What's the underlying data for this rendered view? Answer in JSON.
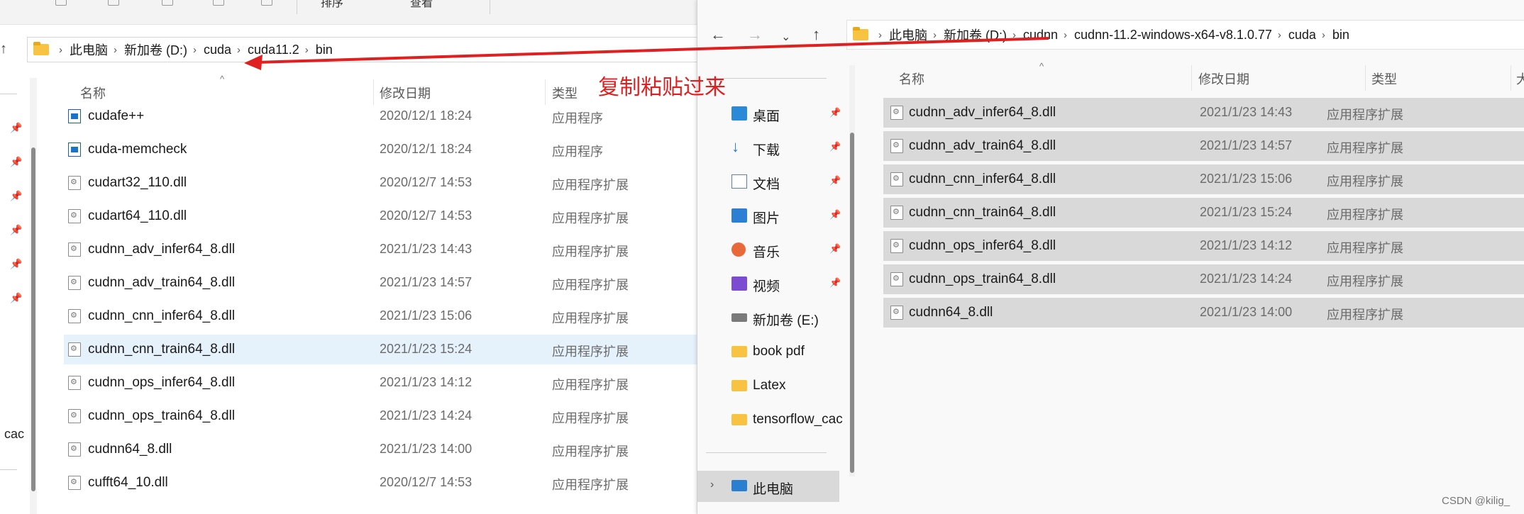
{
  "left_window": {
    "breadcrumb": [
      "此电脑",
      "新加卷 (D:)",
      "cuda",
      "cuda11.2",
      "bin"
    ],
    "columns": [
      "名称",
      "修改日期",
      "类型"
    ],
    "files": [
      {
        "name": "cudafe++",
        "date": "2020/12/1 18:24",
        "type": "应用程序",
        "icon": "exe-icon"
      },
      {
        "name": "cuda-memcheck",
        "date": "2020/12/1 18:24",
        "type": "应用程序",
        "icon": "exe-icon"
      },
      {
        "name": "cudart32_110.dll",
        "date": "2020/12/7 14:53",
        "type": "应用程序扩展",
        "icon": "dll-icon"
      },
      {
        "name": "cudart64_110.dll",
        "date": "2020/12/7 14:53",
        "type": "应用程序扩展",
        "icon": "dll-icon"
      },
      {
        "name": "cudnn_adv_infer64_8.dll",
        "date": "2021/1/23 14:43",
        "type": "应用程序扩展",
        "icon": "dll-icon"
      },
      {
        "name": "cudnn_adv_train64_8.dll",
        "date": "2021/1/23 14:57",
        "type": "应用程序扩展",
        "icon": "dll-icon"
      },
      {
        "name": "cudnn_cnn_infer64_8.dll",
        "date": "2021/1/23 15:06",
        "type": "应用程序扩展",
        "icon": "dll-icon"
      },
      {
        "name": "cudnn_cnn_train64_8.dll",
        "date": "2021/1/23 15:24",
        "type": "应用程序扩展",
        "icon": "dll-icon"
      },
      {
        "name": "cudnn_ops_infer64_8.dll",
        "date": "2021/1/23 14:12",
        "type": "应用程序扩展",
        "icon": "dll-icon"
      },
      {
        "name": "cudnn_ops_train64_8.dll",
        "date": "2021/1/23 14:24",
        "type": "应用程序扩展",
        "icon": "dll-icon"
      },
      {
        "name": "cudnn64_8.dll",
        "date": "2021/1/23 14:00",
        "type": "应用程序扩展",
        "icon": "dll-icon"
      },
      {
        "name": "cufft64_10.dll",
        "date": "2020/12/7 14:53",
        "type": "应用程序扩展",
        "icon": "dll-icon"
      }
    ],
    "nav_partial_label": "cac",
    "toolbar_partial": [
      "排序",
      "查看"
    ]
  },
  "right_window": {
    "breadcrumb": [
      "此电脑",
      "新加卷 (D:)",
      "cudnn",
      "cudnn-11.2-windows-x64-v8.1.0.77",
      "cuda",
      "bin"
    ],
    "columns": [
      "名称",
      "修改日期",
      "类型",
      "大"
    ],
    "nav_items": [
      {
        "label": "桌面",
        "icon": "desktop-icon",
        "pinned": true
      },
      {
        "label": "下载",
        "icon": "download-icon",
        "pinned": true
      },
      {
        "label": "文档",
        "icon": "documents-icon",
        "pinned": true
      },
      {
        "label": "图片",
        "icon": "pictures-icon",
        "pinned": true
      },
      {
        "label": "音乐",
        "icon": "music-icon",
        "pinned": true
      },
      {
        "label": "视频",
        "icon": "video-icon",
        "pinned": true
      },
      {
        "label": "新加卷 (E:)",
        "icon": "drive-icon",
        "pinned": false
      },
      {
        "label": "book pdf",
        "icon": "folder-icon",
        "pinned": false
      },
      {
        "label": "Latex",
        "icon": "folder-icon",
        "pinned": false
      },
      {
        "label": "tensorflow_cac",
        "icon": "folder-icon",
        "pinned": false
      }
    ],
    "this_pc_label": "此电脑",
    "files": [
      {
        "name": "cudnn_adv_infer64_8.dll",
        "date": "2021/1/23 14:43",
        "type": "应用程序扩展"
      },
      {
        "name": "cudnn_adv_train64_8.dll",
        "date": "2021/1/23 14:57",
        "type": "应用程序扩展"
      },
      {
        "name": "cudnn_cnn_infer64_8.dll",
        "date": "2021/1/23 15:06",
        "type": "应用程序扩展"
      },
      {
        "name": "cudnn_cnn_train64_8.dll",
        "date": "2021/1/23 15:24",
        "type": "应用程序扩展"
      },
      {
        "name": "cudnn_ops_infer64_8.dll",
        "date": "2021/1/23 14:12",
        "type": "应用程序扩展"
      },
      {
        "name": "cudnn_ops_train64_8.dll",
        "date": "2021/1/23 14:24",
        "type": "应用程序扩展"
      },
      {
        "name": "cudnn64_8.dll",
        "date": "2021/1/23 14:00",
        "type": "应用程序扩展"
      }
    ]
  },
  "annotation": {
    "text": "复制粘贴过来",
    "color": "#e02020"
  },
  "watermark": "CSDN @kilig_",
  "colors": {
    "selected_row_left": "#e5f1fb",
    "selected_row_right": "#d9d9d9",
    "folder": "#f8c340"
  }
}
